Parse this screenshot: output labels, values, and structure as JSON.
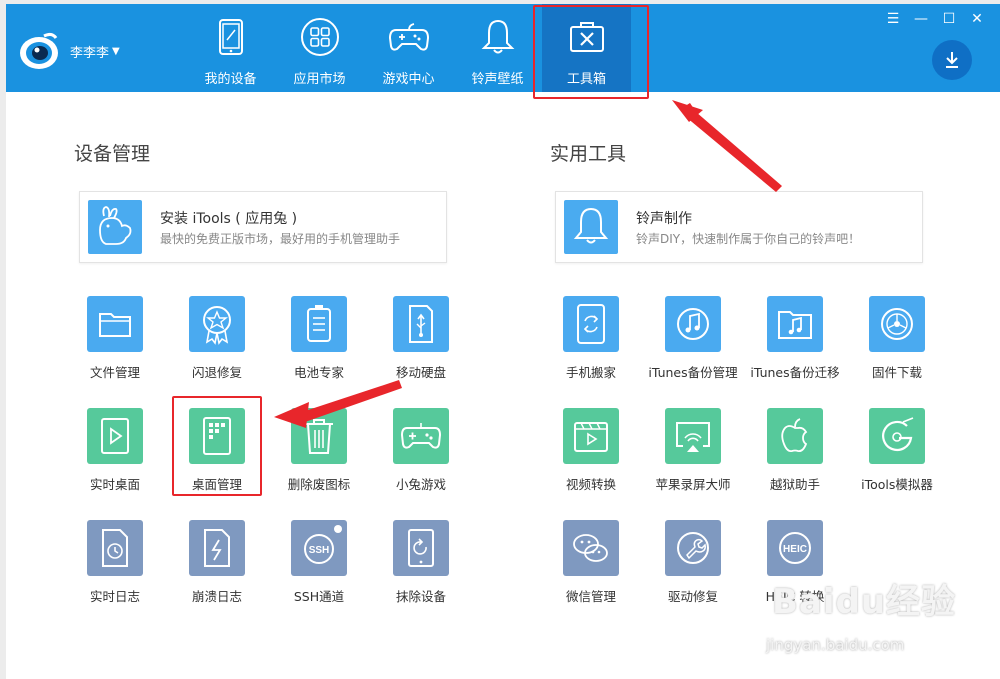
{
  "header": {
    "username": "李李李",
    "nav": [
      {
        "label": "我的设备",
        "icon": "tablet-icon"
      },
      {
        "label": "应用市场",
        "icon": "apps-grid-icon"
      },
      {
        "label": "游戏中心",
        "icon": "gamepad-icon"
      },
      {
        "label": "铃声壁纸",
        "icon": "bell-icon"
      },
      {
        "label": "工具箱",
        "icon": "toolbox-icon"
      }
    ],
    "active_tab": "工具箱",
    "window_controls": [
      "menu-icon",
      "minimize-icon",
      "maximize-icon",
      "close-icon"
    ]
  },
  "device_mgmt": {
    "title": "设备管理",
    "banner": {
      "title": "安装 iTools ( 应用兔 )",
      "desc": "最快的免费正版市场，最好用的手机管理助手",
      "icon": "rabbit-icon"
    },
    "tools": [
      {
        "label": "文件管理",
        "icon": "folder-icon",
        "color": "#4aaaf0"
      },
      {
        "label": "闪退修复",
        "icon": "badge-icon",
        "color": "#4aaaf0"
      },
      {
        "label": "电池专家",
        "icon": "battery-icon",
        "color": "#4aaaf0"
      },
      {
        "label": "移动硬盘",
        "icon": "usb-drive-icon",
        "color": "#4aaaf0"
      },
      {
        "label": "实时桌面",
        "icon": "play-icon",
        "color": "#56c99b"
      },
      {
        "label": "桌面管理",
        "icon": "desktop-grid-icon",
        "color": "#56c99b"
      },
      {
        "label": "删除废图标",
        "icon": "trash-icon",
        "color": "#56c99b"
      },
      {
        "label": "小兔游戏",
        "icon": "gamepad-icon",
        "color": "#56c99b"
      },
      {
        "label": "实时日志",
        "icon": "clock-doc-icon",
        "color": "#7f99c0"
      },
      {
        "label": "崩溃日志",
        "icon": "lightning-doc-icon",
        "color": "#7f99c0"
      },
      {
        "label": "SSH通道",
        "icon": "ssh-icon",
        "text": "SSH",
        "color": "#7f99c0"
      },
      {
        "label": "抹除设备",
        "icon": "erase-icon",
        "color": "#7f99c0"
      }
    ]
  },
  "utilities": {
    "title": "实用工具",
    "banner": {
      "title": "铃声制作",
      "desc": "铃声DIY，快速制作属于你自己的铃声吧！",
      "icon": "bell-icon"
    },
    "tools": [
      {
        "label": "手机搬家",
        "icon": "phone-transfer-icon",
        "color": "#4aaaf0"
      },
      {
        "label": "iTunes备份管理",
        "icon": "music-circle-icon",
        "color": "#4aaaf0"
      },
      {
        "label": "iTunes备份迁移",
        "icon": "music-folder-icon",
        "color": "#4aaaf0"
      },
      {
        "label": "固件下载",
        "icon": "firmware-icon",
        "color": "#4aaaf0"
      },
      {
        "label": "视频转换",
        "icon": "video-icon",
        "color": "#56c99b"
      },
      {
        "label": "苹果录屏大师",
        "icon": "airplay-icon",
        "color": "#56c99b"
      },
      {
        "label": "越狱助手",
        "icon": "apple-icon",
        "color": "#56c99b"
      },
      {
        "label": "iTools模拟器",
        "icon": "emulator-icon",
        "color": "#56c99b"
      },
      {
        "label": "微信管理",
        "icon": "wechat-icon",
        "color": "#7f99c0"
      },
      {
        "label": "驱动修复",
        "icon": "wrench-icon",
        "color": "#7f99c0"
      },
      {
        "label": "HEIC 转换",
        "icon": "heic-icon",
        "text": "HEIC",
        "color": "#7f99c0"
      }
    ]
  },
  "watermark": {
    "main": "Baidu经验",
    "sub": "jingyan.baidu.com"
  }
}
